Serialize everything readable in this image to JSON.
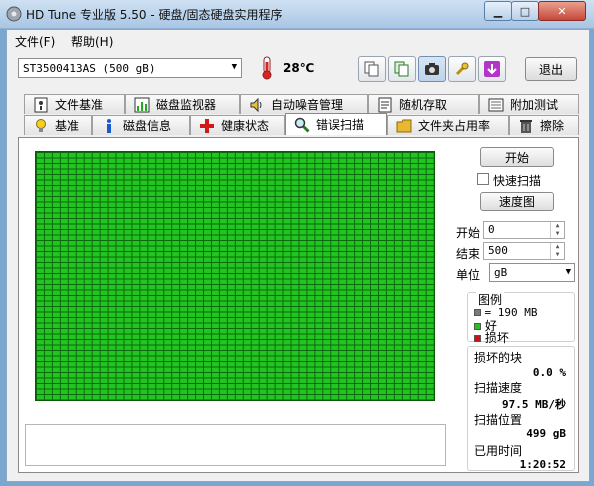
{
  "window": {
    "title": "HD Tune 专业版 5.50 - 硬盘/固态硬盘实用程序"
  },
  "menu": [
    {
      "label": "文件(F)"
    },
    {
      "label": "帮助(H)"
    }
  ],
  "toolbar": {
    "drive": "ST3500413AS (500 gB)",
    "temperature": "28℃",
    "exit_label": "退出"
  },
  "tabs_top": [
    {
      "label": "文件基准",
      "icon": "file-benchmark-icon"
    },
    {
      "label": "磁盘监视器",
      "icon": "disk-monitor-icon"
    },
    {
      "label": "自动噪音管理",
      "icon": "speaker-icon"
    },
    {
      "label": "随机存取",
      "icon": "random-access-icon"
    },
    {
      "label": "附加测试",
      "icon": "extra-tests-icon"
    }
  ],
  "tabs_bottom": [
    {
      "label": "基准",
      "icon": "lightbulb-icon"
    },
    {
      "label": "磁盘信息",
      "icon": "info-icon"
    },
    {
      "label": "健康状态",
      "icon": "health-cross-icon"
    },
    {
      "label": "错误扫描",
      "icon": "magnifier-icon",
      "active": true
    },
    {
      "label": "文件夹占用率",
      "icon": "folder-icon"
    },
    {
      "label": "擦除",
      "icon": "trash-icon"
    }
  ],
  "scan": {
    "start_label": "开始",
    "quick_scan_label": "快速扫描",
    "quick_scan_checked": false,
    "speed_map_label": "速度图",
    "start_field_label": "开始",
    "start_value": "0",
    "end_field_label": "结束",
    "end_value": "500",
    "unit_label": "单位",
    "unit_value": "gB"
  },
  "legend": {
    "title": "图例",
    "block_size": "= 190 MB",
    "good_label": "好",
    "bad_label": "损坏",
    "colors": {
      "block": "#7a7a7a",
      "good": "#22c422",
      "bad": "#d01010"
    }
  },
  "stats": {
    "damaged_blocks_label": "损坏的块",
    "damaged_blocks_value": "0.0 %",
    "scan_speed_label": "扫描速度",
    "scan_speed_value": "97.5 MB/秒",
    "scan_position_label": "扫描位置",
    "scan_position_value": "499 gB",
    "elapsed_label": "已用时间",
    "elapsed_value": "1:20:52"
  },
  "grid": {
    "columns": 50,
    "rows": 45,
    "status": "all-good"
  }
}
